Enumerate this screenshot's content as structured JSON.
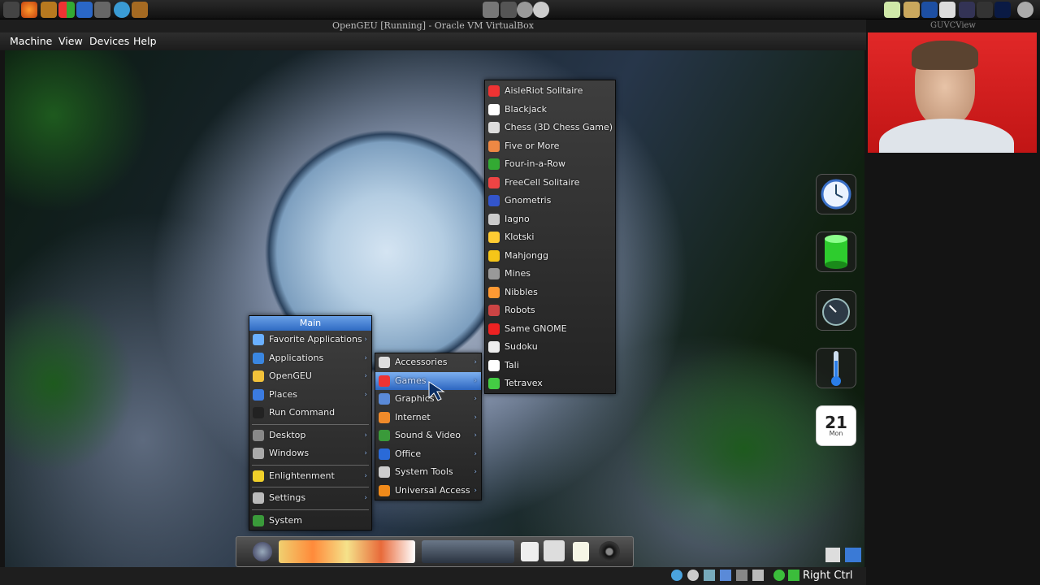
{
  "host": {
    "window_title": "OpenGEU [Running] - Oracle VM VirtualBox",
    "camera_window_title": "GUVCView"
  },
  "vbox_menu": [
    "Machine",
    "View",
    "Devices",
    "Help"
  ],
  "status": {
    "host_key": "Right Ctrl"
  },
  "main_menu": {
    "title": "Main",
    "groups": [
      [
        "Favorite Applications",
        "Applications",
        "OpenGEU",
        "Places",
        "Run Command"
      ],
      [
        "Desktop",
        "Windows"
      ],
      [
        "Enlightenment"
      ],
      [
        "Settings"
      ],
      [
        "System"
      ]
    ]
  },
  "apps_menu": {
    "items": [
      "Accessories",
      "Games",
      "Graphics",
      "Internet",
      "Sound & Video",
      "Office",
      "System Tools",
      "Universal Access"
    ],
    "highlighted": "Games"
  },
  "games_menu": {
    "items": [
      "AisleRiot Solitaire",
      "Blackjack",
      "Chess (3D Chess Game)",
      "Five or More",
      "Four-in-a-Row",
      "FreeCell Solitaire",
      "Gnometris",
      "Iagno",
      "Klotski",
      "Mahjongg",
      "Mines",
      "Nibbles",
      "Robots",
      "Same GNOME",
      "Sudoku",
      "Tali",
      "Tetravex"
    ]
  },
  "calendar": {
    "day": "21",
    "weekday": "Mon"
  },
  "colors": {
    "menu_highlight": "#2d66c0",
    "webcam_bg": "#e12828",
    "status_green": "#3bbd3b"
  }
}
